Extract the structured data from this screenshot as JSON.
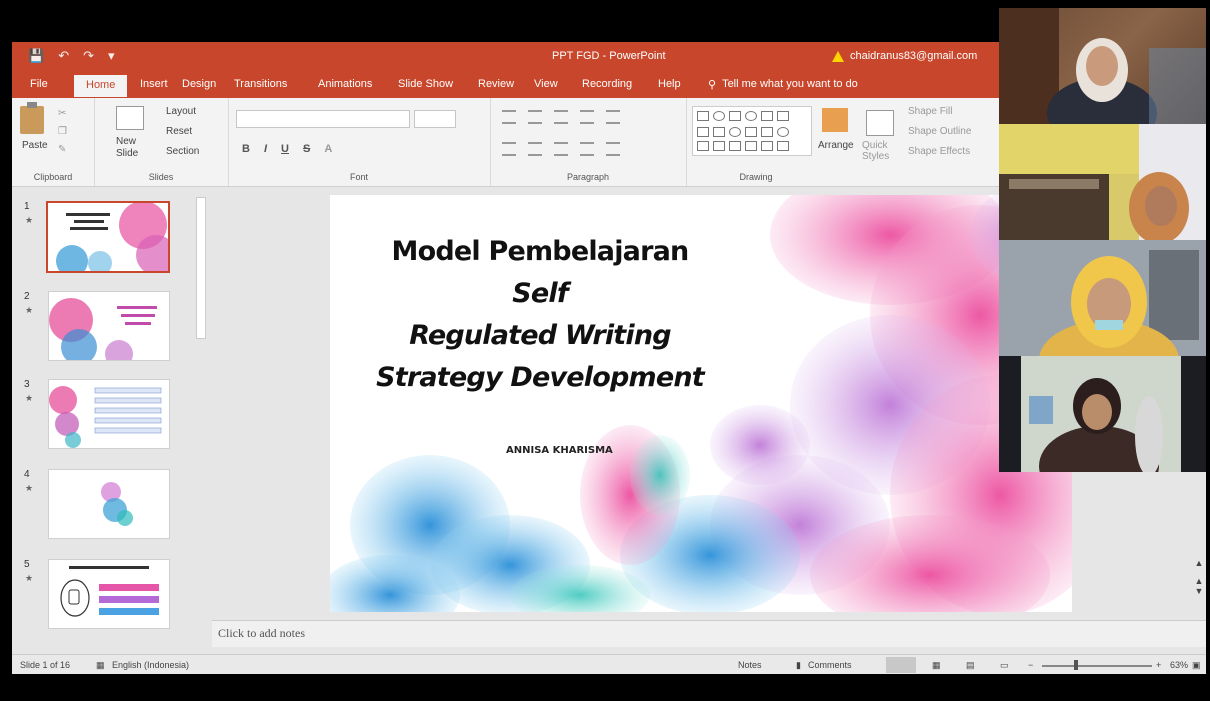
{
  "window": {
    "title": "PPT FGD - PowerPoint",
    "account": "chaidranus83@gmail.com",
    "tell_me": "Tell me what you want to do"
  },
  "tabs": [
    "File",
    "Home",
    "Insert",
    "Design",
    "Transitions",
    "Animations",
    "Slide Show",
    "Review",
    "View",
    "Recording",
    "Help"
  ],
  "ribbon": {
    "clipboard": {
      "label": "Clipboard",
      "paste": "Paste"
    },
    "slides": {
      "label": "Slides",
      "new_slide": "New Slide",
      "layout": "Layout",
      "reset": "Reset",
      "section": "Section"
    },
    "font": {
      "label": "Font"
    },
    "paragraph": {
      "label": "Paragraph"
    },
    "drawing": {
      "label": "Drawing",
      "arrange": "Arrange",
      "quick_styles": "Quick Styles",
      "shape_fill": "Shape Fill",
      "shape_outline": "Shape Outline",
      "shape_effects": "Shape Effects"
    }
  },
  "thumbnails": [
    {
      "number": "1"
    },
    {
      "number": "2"
    },
    {
      "number": "3"
    },
    {
      "number": "4"
    },
    {
      "number": "5"
    }
  ],
  "slide": {
    "title_line1": "Model Pembelajaran",
    "title_line1_italic": "Self",
    "title_line2": "Regulated Writing",
    "title_line3": "Strategy Development",
    "author": "ANNISA KHARISMA"
  },
  "notes_placeholder": "Click to add notes",
  "status": {
    "slide_count": "Slide 1 of 16",
    "language": "English (Indonesia)",
    "notes": "Notes",
    "comments": "Comments",
    "zoom": "63%"
  },
  "colors": {
    "accent": "#c8472c",
    "ribbon": "#f3f3f3"
  },
  "participants": [
    {
      "icon": "participant-video-icon"
    },
    {
      "icon": "participant-video-icon"
    },
    {
      "icon": "participant-video-icon"
    },
    {
      "icon": "participant-video-icon"
    }
  ]
}
